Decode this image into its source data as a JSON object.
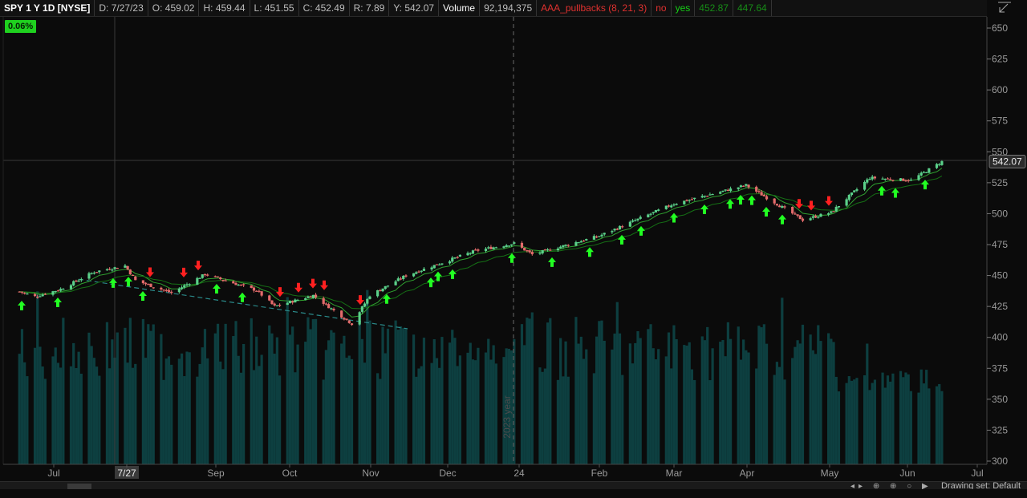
{
  "header": {
    "symbol": "SPY 1 Y 1D [NYSE]",
    "date": "D: 7/27/23",
    "open": "O: 459.02",
    "high": "H: 459.44",
    "low": "L: 451.55",
    "close": "C: 452.49",
    "range": "R: 7.89",
    "y": "Y: 542.07",
    "volume_label": "Volume",
    "volume_value": "92,194,375",
    "study": "AAA_pullbacks (8, 21, 3)",
    "no": "no",
    "yes": "yes",
    "val1": "452.87",
    "val2": "447.64"
  },
  "badge": "0.06%",
  "bottom": {
    "drawing_set": "Drawing set: Default"
  },
  "colors": {
    "up": "#5bd18a",
    "down": "#e36b6b",
    "ema_fast": "#2fa02f",
    "ema_slow": "#157015",
    "volume": "#0d3f40",
    "arrow_up": "#22ff22",
    "arrow_down": "#ff2020",
    "trend": "#2a8a8a"
  },
  "chart_data": {
    "type": "candlestick",
    "title": "SPY 1 Y 1D [NYSE]",
    "ylim": [
      295,
      655
    ],
    "y_ticks": [
      300,
      325,
      350,
      375,
      400,
      425,
      450,
      475,
      500,
      525,
      550,
      575,
      600,
      625,
      650
    ],
    "x_tick_labels": [
      "Jul",
      "7/27",
      "Sep",
      "Oct",
      "Nov",
      "Dec",
      "24",
      "Feb",
      "Mar",
      "Apr",
      "May",
      "Jun",
      "Jul"
    ],
    "last_price": "542.07",
    "period_label": "2023 year",
    "anchors": [
      [
        "2023-06-20",
        437
      ],
      [
        "2023-06-26",
        433
      ],
      [
        "2023-07-06",
        439
      ],
      [
        "2023-07-19",
        453
      ],
      [
        "2023-07-31",
        458
      ],
      [
        "2023-08-04",
        446
      ],
      [
        "2023-08-18",
        436
      ],
      [
        "2023-08-31",
        451
      ],
      [
        "2023-09-20",
        438
      ],
      [
        "2023-09-27",
        425
      ],
      [
        "2023-10-12",
        434
      ],
      [
        "2023-10-27",
        411
      ],
      [
        "2023-11-03",
        434
      ],
      [
        "2023-11-17",
        450
      ],
      [
        "2023-12-14",
        470
      ],
      [
        "2023-12-29",
        476
      ],
      [
        "2024-01-05",
        467
      ],
      [
        "2024-01-31",
        482
      ],
      [
        "2024-02-29",
        508
      ],
      [
        "2024-03-28",
        523
      ],
      [
        "2024-04-19",
        495
      ],
      [
        "2024-04-30",
        501
      ],
      [
        "2024-05-15",
        529
      ],
      [
        "2024-05-31",
        527
      ],
      [
        "2024-06-12",
        542
      ]
    ]
  }
}
